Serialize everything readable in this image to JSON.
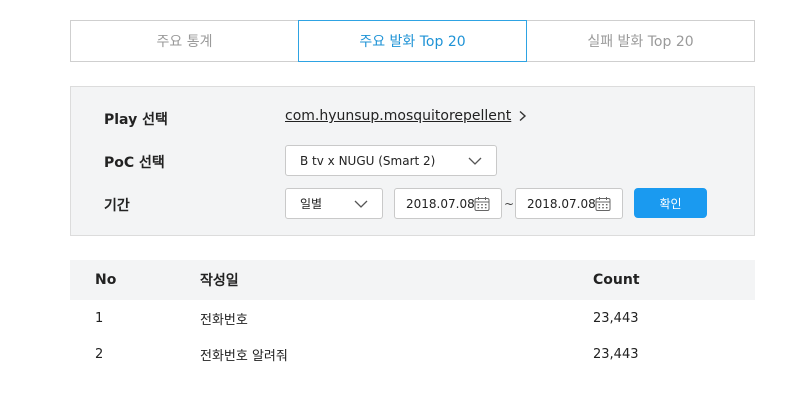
{
  "tabs": [
    {
      "label": "주요 통계",
      "active": false
    },
    {
      "label": "주요 발화  Top 20",
      "active": true
    },
    {
      "label": "실패 발화  Top 20",
      "active": false
    }
  ],
  "filter": {
    "play_label": "Play 선택",
    "play_value": "com.hyunsup.mosquitorepellent",
    "poc_label": "PoC 선택",
    "poc_value": "B tv x NUGU (Smart 2)",
    "period_label": "기간",
    "period_unit": "일별",
    "start_date": "2018.07.08",
    "range_separator": "~",
    "end_date": "2018.07.08",
    "confirm_label": "확인"
  },
  "table": {
    "headers": {
      "no": "No",
      "date": "작성일",
      "count": "Count"
    },
    "rows": [
      {
        "no": "1",
        "date": "전화번호",
        "count": "23,443"
      },
      {
        "no": "2",
        "date": "전화번호 알려줘",
        "count": "23,443"
      }
    ]
  },
  "colors": {
    "accent": "#1a9af0",
    "active_tab_border": "#2ea3e3",
    "panel_bg": "#f3f4f5"
  }
}
